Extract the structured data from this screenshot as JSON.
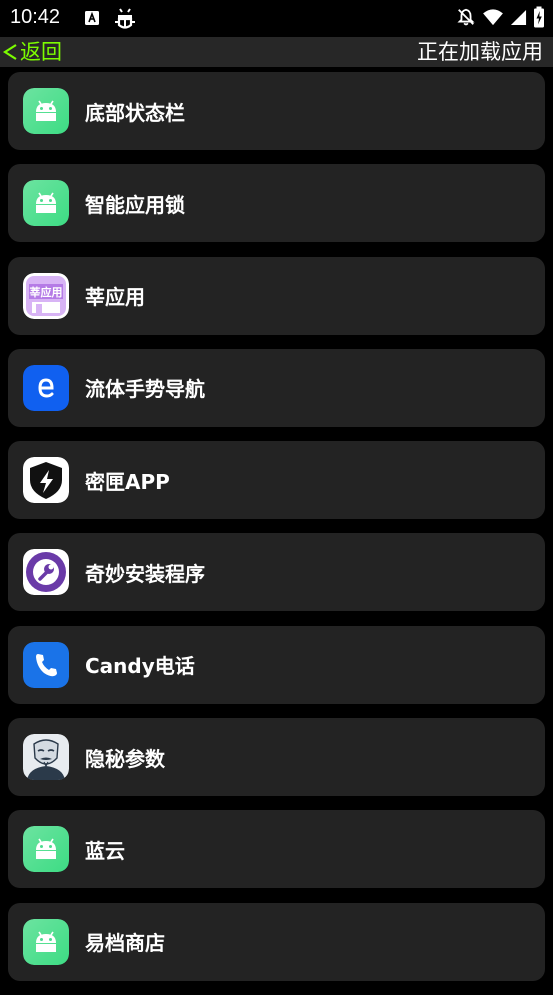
{
  "status_bar": {
    "time": "10:42",
    "icons": [
      "a-notification-icon",
      "bug-icon",
      "bell-off-icon",
      "wifi-icon",
      "signal-icon",
      "battery-icon"
    ]
  },
  "app_bar": {
    "back_label": "返回",
    "title": "正在加载应用"
  },
  "apps": [
    {
      "name": "底部状态栏",
      "icon": "android-icon"
    },
    {
      "name": "智能应用锁",
      "icon": "android-icon"
    },
    {
      "name": "莘应用",
      "icon": "shen-app-icon",
      "icon_text": "莘应用"
    },
    {
      "name": "流体手势导航",
      "icon": "fluid-gesture-icon"
    },
    {
      "name": "密匣APP",
      "icon": "shield-bolt-icon"
    },
    {
      "name": "奇妙安装程序",
      "icon": "wrench-icon"
    },
    {
      "name": "Candy电话",
      "icon": "phone-icon"
    },
    {
      "name": "隐秘参数",
      "icon": "anonymous-mask-icon"
    },
    {
      "name": "蓝云",
      "icon": "android-icon"
    },
    {
      "name": "易档商店",
      "icon": "android-icon"
    }
  ],
  "colors": {
    "accent_back": "#7CFC00",
    "card_bg": "#232323",
    "app_bar_bg": "#272727",
    "android_green": "#3DDC84",
    "android_green_light": "#6CE3A0"
  }
}
